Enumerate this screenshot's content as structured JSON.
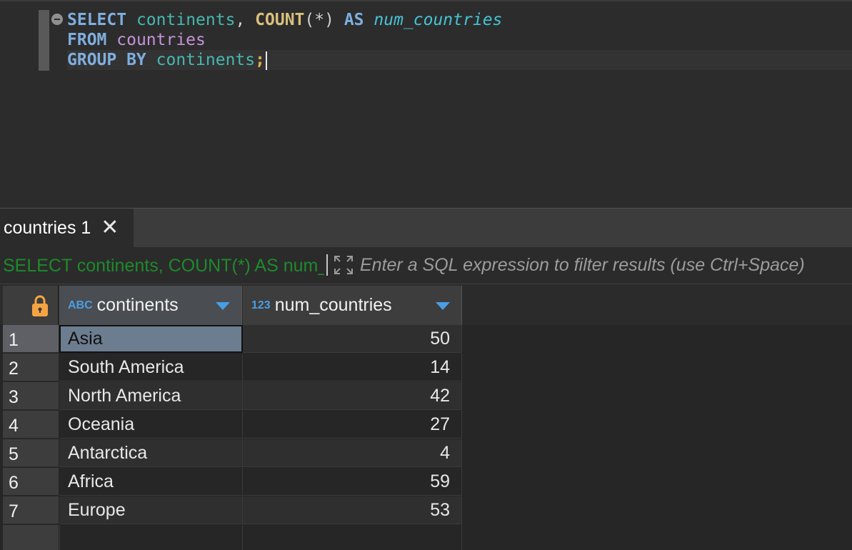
{
  "editor": {
    "line1": {
      "kw_select": "SELECT",
      "col": "continents",
      "comma": ",",
      "fn": "COUNT",
      "args": "(*)",
      "kw_as": "AS",
      "alias": "num_countries"
    },
    "line2": {
      "kw_from": "FROM",
      "table": "countries"
    },
    "line3": {
      "kw_group": "GROUP BY",
      "col": "continents",
      "semi": ";"
    }
  },
  "tabs": [
    {
      "label": "countries 1",
      "close": "✕"
    }
  ],
  "filter": {
    "query_text": "SELECT continents, COUNT(*) AS num_countries FROM countries GROUP BY continents",
    "placeholder": "Enter a SQL expression to filter results (use Ctrl+Space)"
  },
  "grid": {
    "columns": [
      {
        "type": "ABC",
        "name": "continents"
      },
      {
        "type": "123",
        "name": "num_countries"
      }
    ],
    "rows": [
      {
        "num": "1",
        "continent": "Asia",
        "count": "50"
      },
      {
        "num": "2",
        "continent": "South America",
        "count": "14"
      },
      {
        "num": "3",
        "continent": "North America",
        "count": "42"
      },
      {
        "num": "4",
        "continent": "Oceania",
        "count": "27"
      },
      {
        "num": "5",
        "continent": "Antarctica",
        "count": "4"
      },
      {
        "num": "6",
        "continent": "Africa",
        "count": "59"
      },
      {
        "num": "7",
        "continent": "Europe",
        "count": "53"
      }
    ]
  },
  "icons": {
    "lock": "lock-icon",
    "sort": "sort-arrow-icon",
    "expand": "expand-icon",
    "fold": "fold-icon"
  },
  "colors": {
    "accent_blue": "#4a9ee3",
    "lock_orange": "#f5a442",
    "filter_green": "#1e8a2b"
  }
}
